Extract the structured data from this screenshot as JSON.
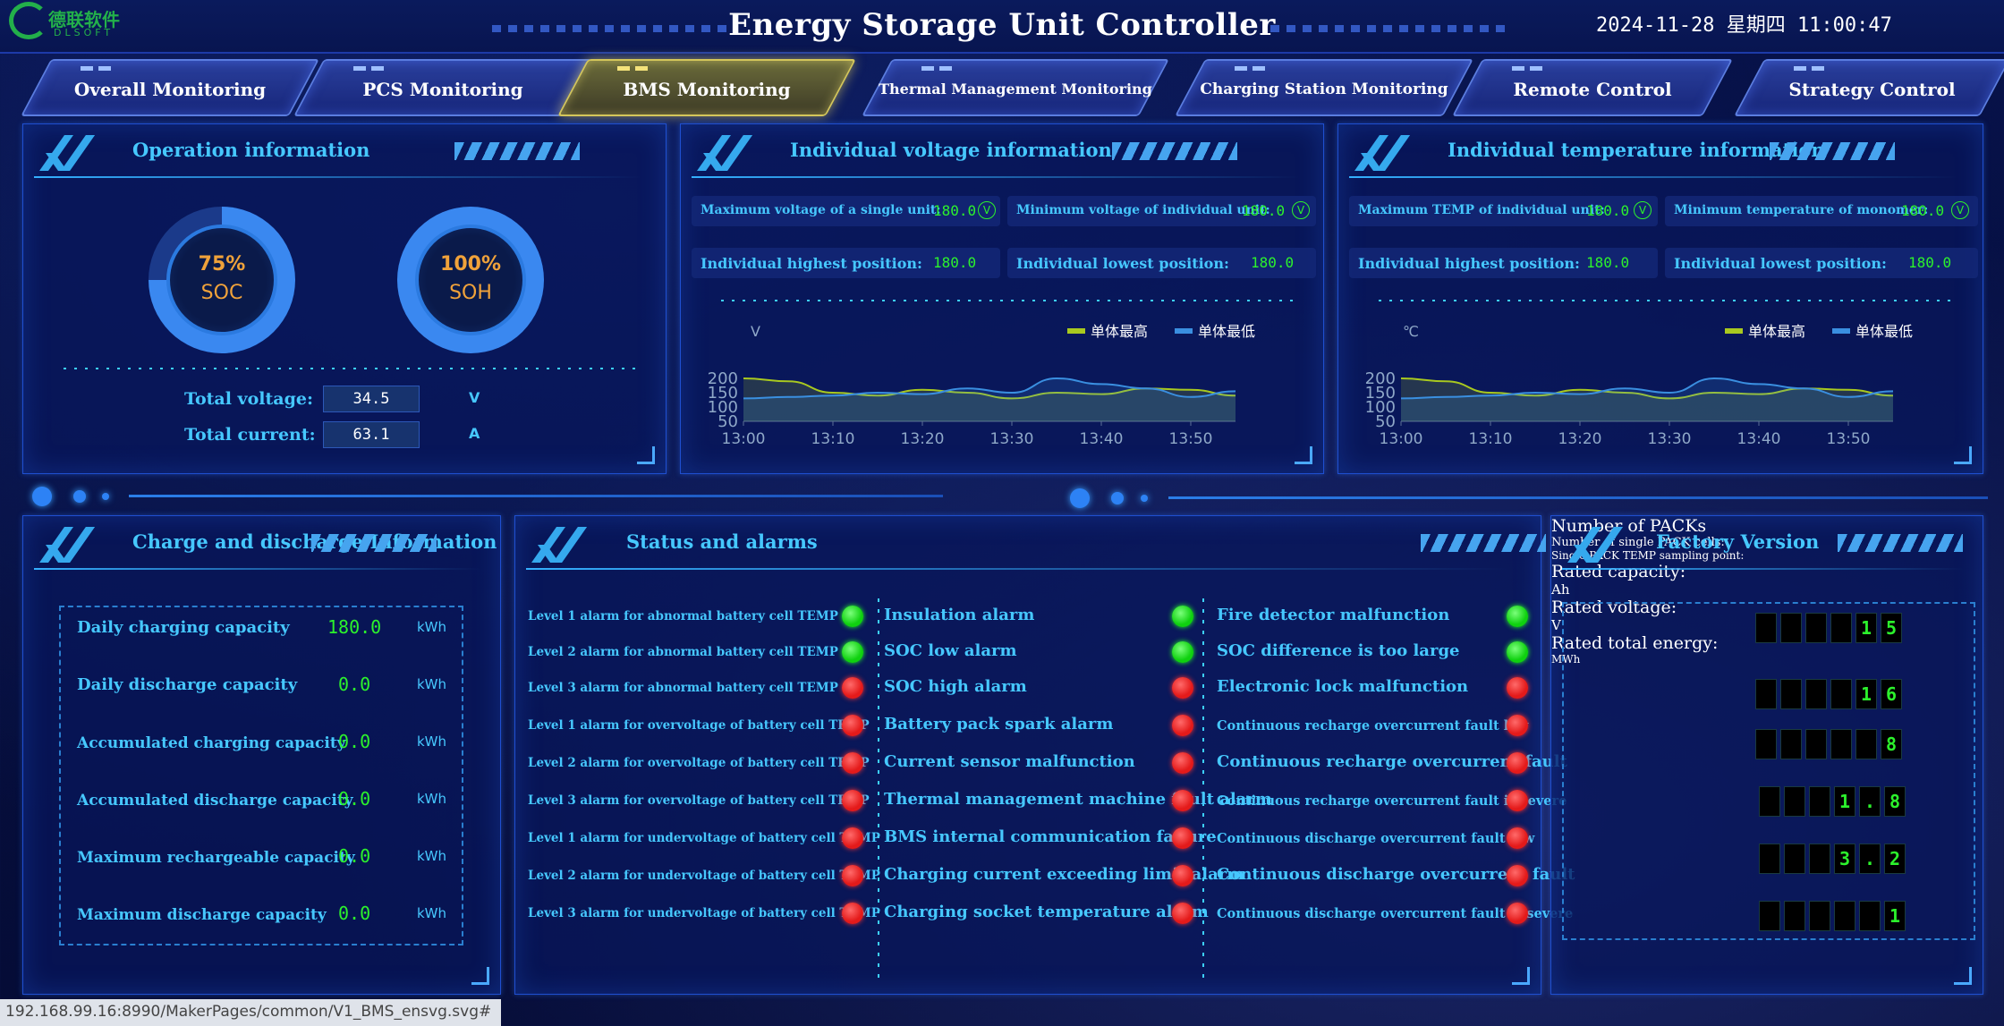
{
  "header": {
    "logo_cn": "德联软件",
    "logo_en": "DLSOFT",
    "title": "Energy Storage Unit Controller",
    "datetime": "2024-11-28  星期四  11:00:47"
  },
  "tabs": [
    {
      "label": "Overall Monitoring",
      "active": false
    },
    {
      "label": "PCS Monitoring",
      "active": false
    },
    {
      "label": "BMS Monitoring",
      "active": true
    },
    {
      "label": "Thermal Management Monitoring",
      "active": false
    },
    {
      "label": "Charging Station Monitoring",
      "active": false
    },
    {
      "label": "Remote Control",
      "active": false
    },
    {
      "label": "Strategy Control",
      "active": false
    }
  ],
  "operation": {
    "title": "Operation information",
    "soc": {
      "pct": "75%",
      "name": "SOC",
      "value": 0.75
    },
    "soh": {
      "pct": "100%",
      "name": "SOH",
      "value": 1.0
    },
    "total_voltage_label": "Total voltage:",
    "total_voltage": "34.5",
    "total_voltage_unit": "V",
    "total_current_label": "Total current:",
    "total_current": "63.1",
    "total_current_unit": "A"
  },
  "voltage": {
    "title": "Individual voltage information",
    "max_label": "Maximum voltage of a single unit:",
    "max_value": "180.0",
    "min_label": "Minimum voltage of individual unit:",
    "min_value": "180.0",
    "unit_badge": "V",
    "high_pos_label": "Individual highest position:",
    "high_pos_value": "180.0",
    "low_pos_label": "Individual lowest position:",
    "low_pos_value": "180.0"
  },
  "temperature": {
    "title": "Individual temperature information",
    "max_label": "Maximum TEMP of individual unit:",
    "max_value": "180.0",
    "min_label": "Minimum temperature of monomer:",
    "min_value": "180.0",
    "unit_badge": "V",
    "high_pos_label": "Individual highest position:",
    "high_pos_value": "180.0",
    "low_pos_label": "Individual lowest position:",
    "low_pos_value": "180.0"
  },
  "chart_data": [
    {
      "type": "area",
      "ylabel": "V",
      "x": [
        "13:00",
        "13:05",
        "13:10",
        "13:15",
        "13:20",
        "13:25",
        "13:30",
        "13:35",
        "13:40",
        "13:45",
        "13:50",
        "13:55"
      ],
      "yticks": [
        50,
        100,
        150,
        200
      ],
      "ylim": [
        50,
        250
      ],
      "legend_position": "top-right",
      "colors": {
        "high": "#a9c91f",
        "low": "#3a8fe0"
      },
      "series": [
        {
          "name": "单体最高",
          "values": [
            200,
            190,
            150,
            140,
            160,
            150,
            130,
            150,
            145,
            165,
            160,
            140
          ]
        },
        {
          "name": "单体最低",
          "values": [
            130,
            135,
            140,
            150,
            145,
            165,
            150,
            200,
            180,
            165,
            135,
            155
          ]
        }
      ]
    },
    {
      "type": "area",
      "ylabel": "℃",
      "x": [
        "13:00",
        "13:05",
        "13:10",
        "13:15",
        "13:20",
        "13:25",
        "13:30",
        "13:35",
        "13:40",
        "13:45",
        "13:50",
        "13:55"
      ],
      "yticks": [
        50,
        100,
        150,
        200
      ],
      "ylim": [
        50,
        250
      ],
      "legend_position": "top-right",
      "colors": {
        "high": "#a9c91f",
        "low": "#3a8fe0"
      },
      "series": [
        {
          "name": "单体最高",
          "values": [
            200,
            190,
            150,
            140,
            160,
            150,
            130,
            150,
            145,
            165,
            160,
            140
          ]
        },
        {
          "name": "单体最低",
          "values": [
            130,
            135,
            140,
            150,
            145,
            165,
            150,
            200,
            180,
            165,
            135,
            155
          ]
        }
      ]
    }
  ],
  "x_tick_labels": [
    "13:00",
    "13:10",
    "13:20",
    "13:30",
    "13:40",
    "13:50"
  ],
  "y_tick_labels": [
    "200",
    "150",
    "100",
    "50"
  ],
  "charge": {
    "title": "Charge and discharge Information",
    "rows": [
      {
        "label": "Daily charging capacity",
        "value": "180.0",
        "unit": "kWh"
      },
      {
        "label": "Daily discharge capacity",
        "value": "0.0",
        "unit": "kWh"
      },
      {
        "label": "Accumulated charging capacity",
        "value": "0.0",
        "unit": "kWh"
      },
      {
        "label": "Accumulated discharge capacity",
        "value": "0.0",
        "unit": "kWh"
      },
      {
        "label": "Maximum rechargeable capacity",
        "value": "0.0",
        "unit": "kWh"
      },
      {
        "label": "Maximum discharge capacity",
        "value": "0.0",
        "unit": "kWh"
      }
    ]
  },
  "alarms": {
    "title": "Status and alarms",
    "col1": [
      {
        "label": "Level 1 alarm for abnormal battery cell TEMP",
        "status": "green"
      },
      {
        "label": "Level 2 alarm for abnormal battery cell TEMP",
        "status": "green"
      },
      {
        "label": "Level 3 alarm for abnormal battery cell TEMP",
        "status": "red"
      },
      {
        "label": "Level 1 alarm for overvoltage of battery cell TEMP",
        "status": "red"
      },
      {
        "label": "Level 2 alarm for overvoltage of battery cell TEMP",
        "status": "red"
      },
      {
        "label": "Level 3 alarm for overvoltage of battery cell TEMP",
        "status": "red"
      },
      {
        "label": "Level 1 alarm for undervoltage of battery cell TEMP",
        "status": "red"
      },
      {
        "label": "Level 2 alarm for undervoltage of battery cell TEMP",
        "status": "red"
      },
      {
        "label": "Level 3 alarm for undervoltage of battery cell TEMP",
        "status": "red"
      }
    ],
    "col2": [
      {
        "label": "Insulation alarm",
        "status": "green"
      },
      {
        "label": "SOC low alarm",
        "status": "green"
      },
      {
        "label": "SOC high alarm",
        "status": "red"
      },
      {
        "label": "Battery pack spark alarm",
        "status": "red"
      },
      {
        "label": "Current sensor malfunction",
        "status": "red"
      },
      {
        "label": "Thermal management machine fault alarm",
        "status": "red"
      },
      {
        "label": "BMS internal communication failure",
        "status": "red"
      },
      {
        "label": "Charging current exceeding limit alarm",
        "status": "red"
      },
      {
        "label": "Charging socket temperature alarm",
        "status": "red"
      }
    ],
    "col3": [
      {
        "label": "Fire detector malfunction",
        "status": "green"
      },
      {
        "label": "SOC difference is too large",
        "status": "green"
      },
      {
        "label": "Electronic lock malfunction",
        "status": "red"
      },
      {
        "label": "Continuous recharge overcurrent fault low",
        "status": "red"
      },
      {
        "label": "Continuous recharge overcurrent fault",
        "status": "red"
      },
      {
        "label": "Continuous recharge overcurrent fault is severe",
        "status": "red"
      },
      {
        "label": "Continuous discharge overcurrent fault low",
        "status": "red"
      },
      {
        "label": "Continuous discharge overcurrent fault",
        "status": "red"
      },
      {
        "label": "Continuous discharge overcurrent fault is severe",
        "status": "red"
      }
    ]
  },
  "factory": {
    "title": "Factory Version",
    "rows": [
      {
        "label": "Number of PACKs",
        "digits": [
          "",
          "",
          "",
          "",
          "1",
          "5"
        ],
        "unit": ""
      },
      {
        "label": "Number of single PACK cells:",
        "digits": [
          "",
          "",
          "",
          "",
          "1",
          "6"
        ],
        "unit": ""
      },
      {
        "label": "Single PACK TEMP sampling point:",
        "digits": [
          "",
          "",
          "",
          "",
          "",
          "8"
        ],
        "unit": ""
      },
      {
        "label": "Rated capacity:",
        "digits": [
          "",
          "",
          "",
          "1",
          ".",
          "8"
        ],
        "unit": "Ah"
      },
      {
        "label": "Rated voltage:",
        "digits": [
          "",
          "",
          "",
          "3",
          ".",
          "2"
        ],
        "unit": "V"
      },
      {
        "label": "Rated total energy:",
        "digits": [
          "",
          "",
          "",
          "",
          "",
          "1"
        ],
        "unit": "MWh"
      }
    ]
  },
  "statusbar": {
    "url": "192.168.99.16:8990/MakerPages/common/V1_BMS_ensvg.svg#"
  }
}
